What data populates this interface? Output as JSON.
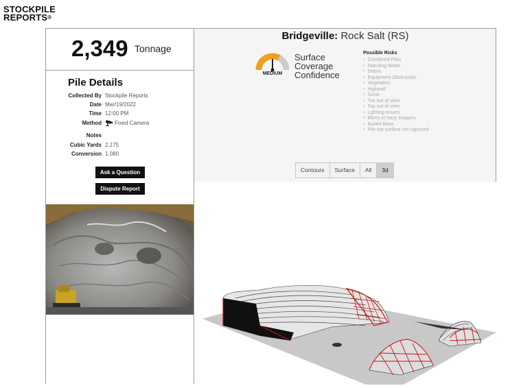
{
  "logo": {
    "line1": "STOCKPILE",
    "line2": "REPORTS",
    "reg": "®"
  },
  "summary": {
    "tonnage_value": "2,349",
    "tonnage_label": "Tonnage"
  },
  "pile_details": {
    "title": "Pile Details",
    "rows": [
      {
        "label": "Collected By",
        "value": "Stockpile Reports"
      },
      {
        "label": "Date",
        "value": "Mar/19/2022"
      },
      {
        "label": "Time",
        "value": "12:00 PM"
      },
      {
        "label": "Method",
        "value": "Fixed Camera"
      },
      {
        "label": "Notes",
        "value": ""
      },
      {
        "label": "Cubic Yards",
        "value": "2,175"
      },
      {
        "label": "Conversion",
        "value": "1.080"
      }
    ],
    "ask_button": "Ask a Question",
    "dispute_button": "Dispute Report"
  },
  "site": {
    "location": "Bridgeville:",
    "material": "Rock Salt (RS)"
  },
  "confidence": {
    "level": "MEDIUM",
    "line1": "Surface",
    "line2": "Coverage",
    "line3": "Confidence",
    "gauge_fraction": 0.5,
    "colors": {
      "low": "#f0a020",
      "medium": "#f0a020",
      "high": "#cccccc",
      "needle": "#222222"
    }
  },
  "risks": {
    "title": "Possible Risks",
    "items": [
      "Combined Piles",
      "Standing Water",
      "Debris",
      "Equipment Obstruction",
      "Vegetation",
      "Highwall",
      "Snow",
      "Toe out of view",
      "Top out of view",
      "Lighting Issues",
      "Blurry or hazy imagery",
      "Buried Base",
      "Pile top surface not captured"
    ]
  },
  "tabs": [
    {
      "label": "Contours",
      "active": false
    },
    {
      "label": "Surface",
      "active": false
    },
    {
      "label": "All",
      "active": false
    },
    {
      "label": "3d",
      "active": true
    }
  ],
  "icons": {
    "method": "camera-icon"
  },
  "colors": {
    "accent_red": "#cc1111",
    "button_bg": "#111111",
    "tab_active": "#cfcfcf"
  }
}
